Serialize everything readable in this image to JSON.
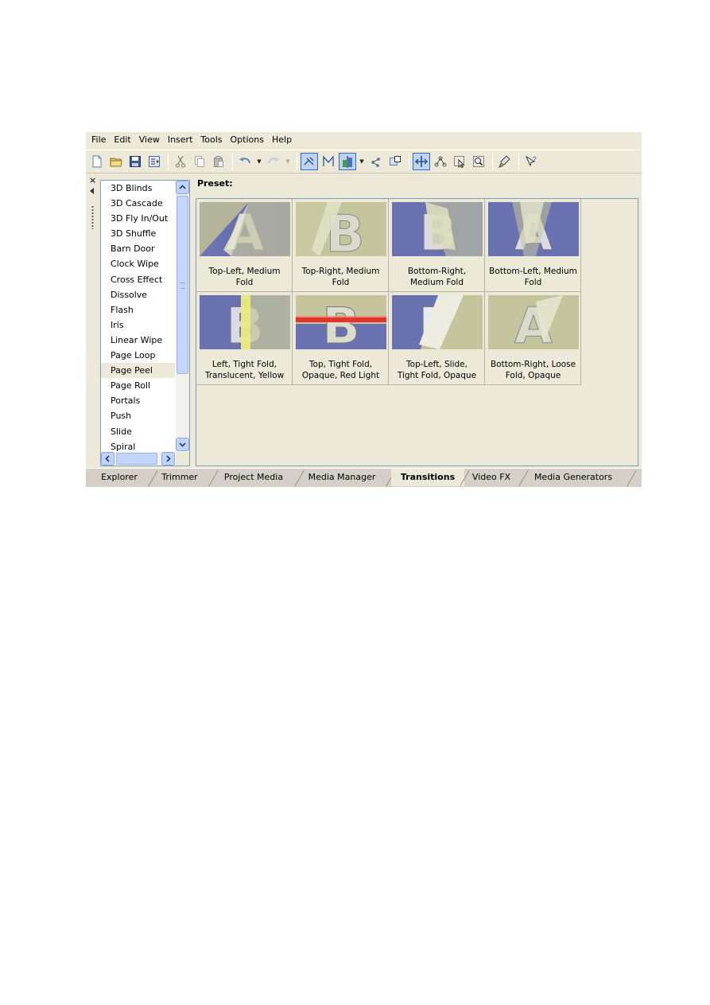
{
  "menu": [
    "File",
    "Edit",
    "View",
    "Insert",
    "Tools",
    "Options",
    "Help"
  ],
  "toolbar": {
    "icons": [
      "new-icon",
      "open-icon",
      "save-icon",
      "properties-icon",
      "cut-icon",
      "copy-icon",
      "paste-icon",
      "undo-icon",
      "redo-icon",
      "auto-ripple-icon",
      "snap-icon",
      "ignore-grouping-icon",
      "lock-envelopes-icon",
      "enable-snapping-icon",
      "normal-edit-tool-icon",
      "envelope-edit-tool-icon",
      "selection-edit-tool-icon",
      "zoom-edit-tool-icon",
      "cleanup-icon",
      "whats-this-icon"
    ]
  },
  "transitions": {
    "items": [
      "3D Blinds",
      "3D Cascade",
      "3D Fly In/Out",
      "3D Shuffle",
      "Barn Door",
      "Clock Wipe",
      "Cross Effect",
      "Dissolve",
      "Flash",
      "Iris",
      "Linear Wipe",
      "Page Loop",
      "Page Peel",
      "Page Roll",
      "Portals",
      "Push",
      "Slide",
      "Spiral"
    ],
    "selected": "Page Peel"
  },
  "preset": {
    "label": "Preset:",
    "items": [
      {
        "line1": "Top-Left, Medium",
        "line2": "Fold"
      },
      {
        "line1": "Top-Right, Medium",
        "line2": "Fold"
      },
      {
        "line1": "Bottom-Right,",
        "line2": "Medium Fold"
      },
      {
        "line1": "Bottom-Left, Medium",
        "line2": "Fold"
      },
      {
        "line1": "Left, Tight Fold,",
        "line2": "Translucent, Yellow"
      },
      {
        "line1": "Top, Tight Fold,",
        "line2": "Opaque, Red Light"
      },
      {
        "line1": "Top-Left, Slide,",
        "line2": "Tight Fold, Opaque"
      },
      {
        "line1": "Bottom-Right, Loose",
        "line2": "Fold, Opaque"
      }
    ]
  },
  "tabs": [
    "Explorer",
    "Trimmer",
    "Project Media",
    "Media Manager",
    "Transitions",
    "Video FX",
    "Media Generators"
  ],
  "active_tab": "Transitions",
  "colors": {
    "chrome": "#ece9d8",
    "selection_border": "#316ac5",
    "list_border": "#7f9db9"
  }
}
